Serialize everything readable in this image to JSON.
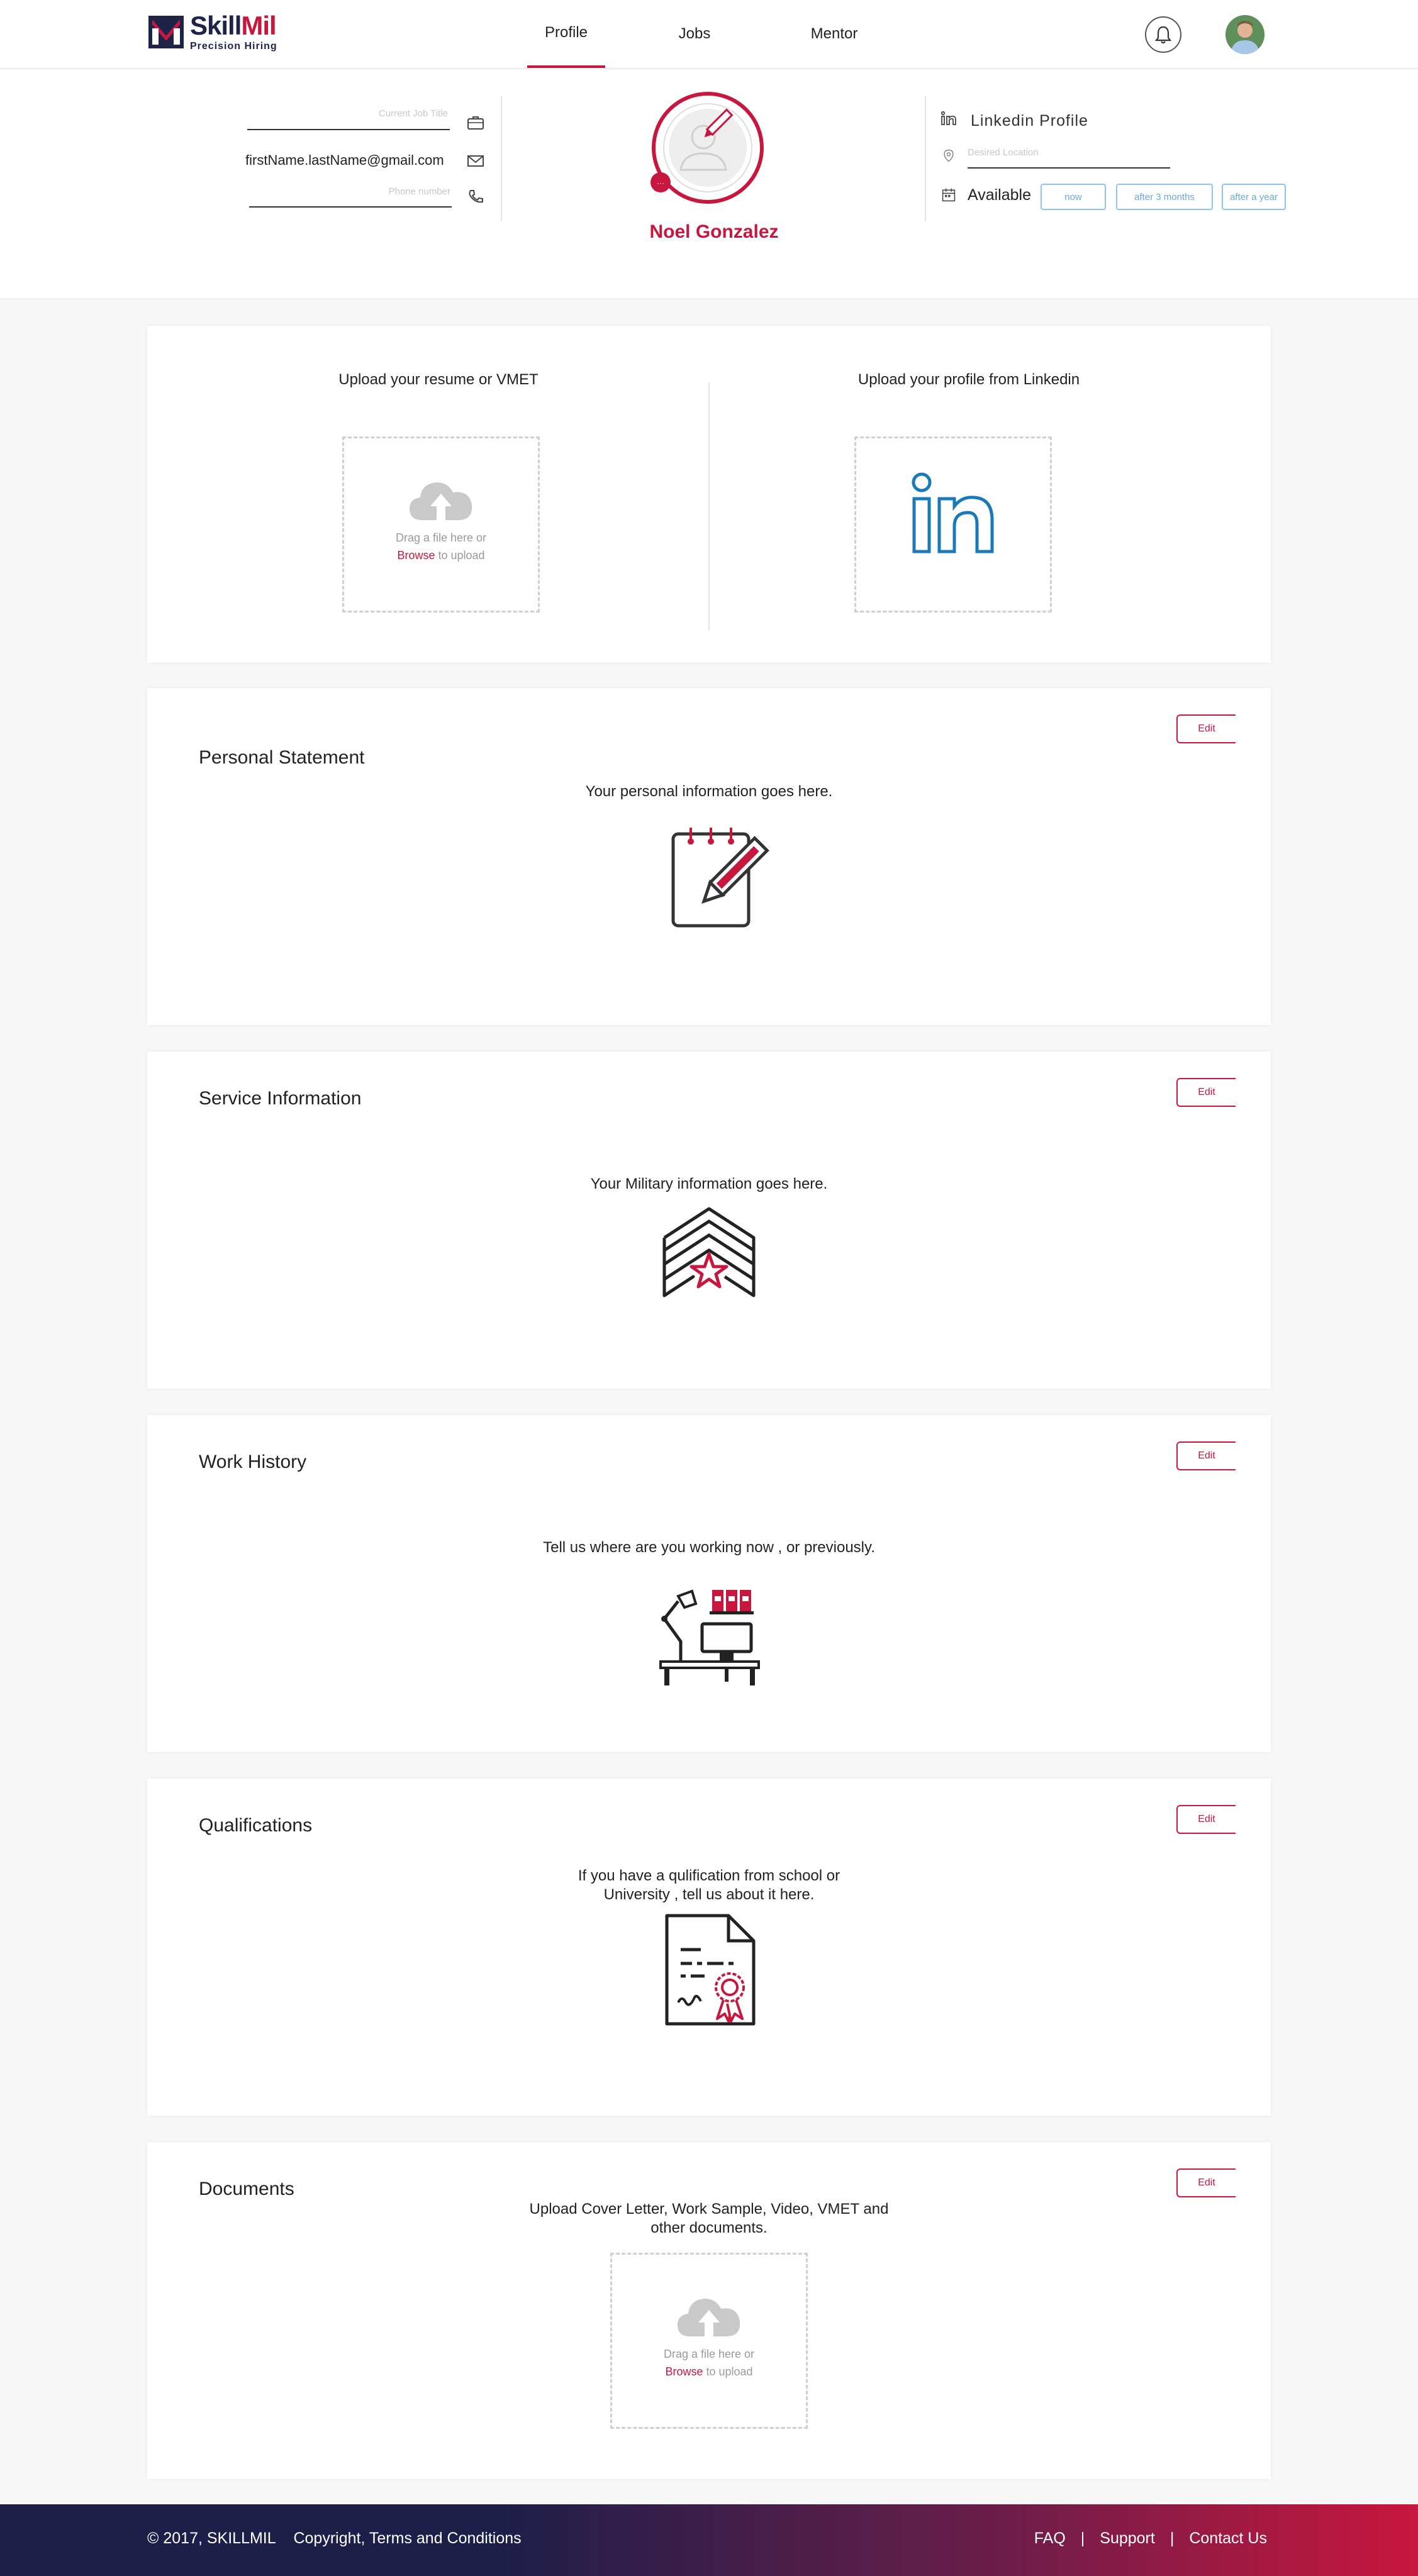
{
  "header": {
    "brand": {
      "name_part1": "Skill",
      "name_part2": "Mil",
      "tagline": "Precision   Hiring"
    },
    "nav": [
      {
        "label": "Profile",
        "active": true
      },
      {
        "label": "Jobs",
        "active": false
      },
      {
        "label": "Mentor",
        "active": false
      }
    ],
    "icons": {
      "notifications": "bell-icon",
      "avatar": "user-avatar"
    }
  },
  "profile": {
    "current_job_title_placeholder": "Current Job Title",
    "email": "firstName.lastName@gmail.com",
    "phone_placeholder": "Phone number",
    "name": "Noel Gonzalez",
    "photo_badge": "···",
    "linkedin_label": "Linkedin Profile",
    "desired_location_placeholder": "Desired Location",
    "availability": {
      "label": "Available",
      "options": [
        "now",
        "after 3 months",
        "after a year"
      ]
    },
    "colors": {
      "accent": "#c8173e",
      "navy": "#1e2348",
      "pill_blue": "#8ec3ef"
    }
  },
  "upload": {
    "resume_title": "Upload your resume or VMET",
    "linkedin_title": "Upload your profile from Linkedin",
    "drag_text": "Drag a file here or",
    "browse": "Browse",
    "to_upload": " to upload"
  },
  "sections": {
    "personal": {
      "title": "Personal Statement",
      "text": "Your personal information goes here.",
      "edit": "Edit"
    },
    "service": {
      "title": "Service Information",
      "text": "Your Military information goes here.",
      "edit": "Edit"
    },
    "work": {
      "title": "Work History",
      "text": "Tell us where are you working now , or previously.",
      "edit": "Edit"
    },
    "qualifications": {
      "title": "Qualifications",
      "text_line1": "If you have a qulification from school or",
      "text_line2": "University , tell us about it here.",
      "edit": "Edit"
    },
    "documents": {
      "title": "Documents",
      "text_line1": "Upload Cover Letter, Work Sample, Video, VMET and",
      "text_line2": "other documents.",
      "edit": "Edit"
    }
  },
  "footer": {
    "copyright": "© 2017, SKILLMIL",
    "terms": "Copyright, Terms and Conditions",
    "links": [
      "FAQ",
      "Support",
      "Contact Us"
    ],
    "separator": "|"
  }
}
